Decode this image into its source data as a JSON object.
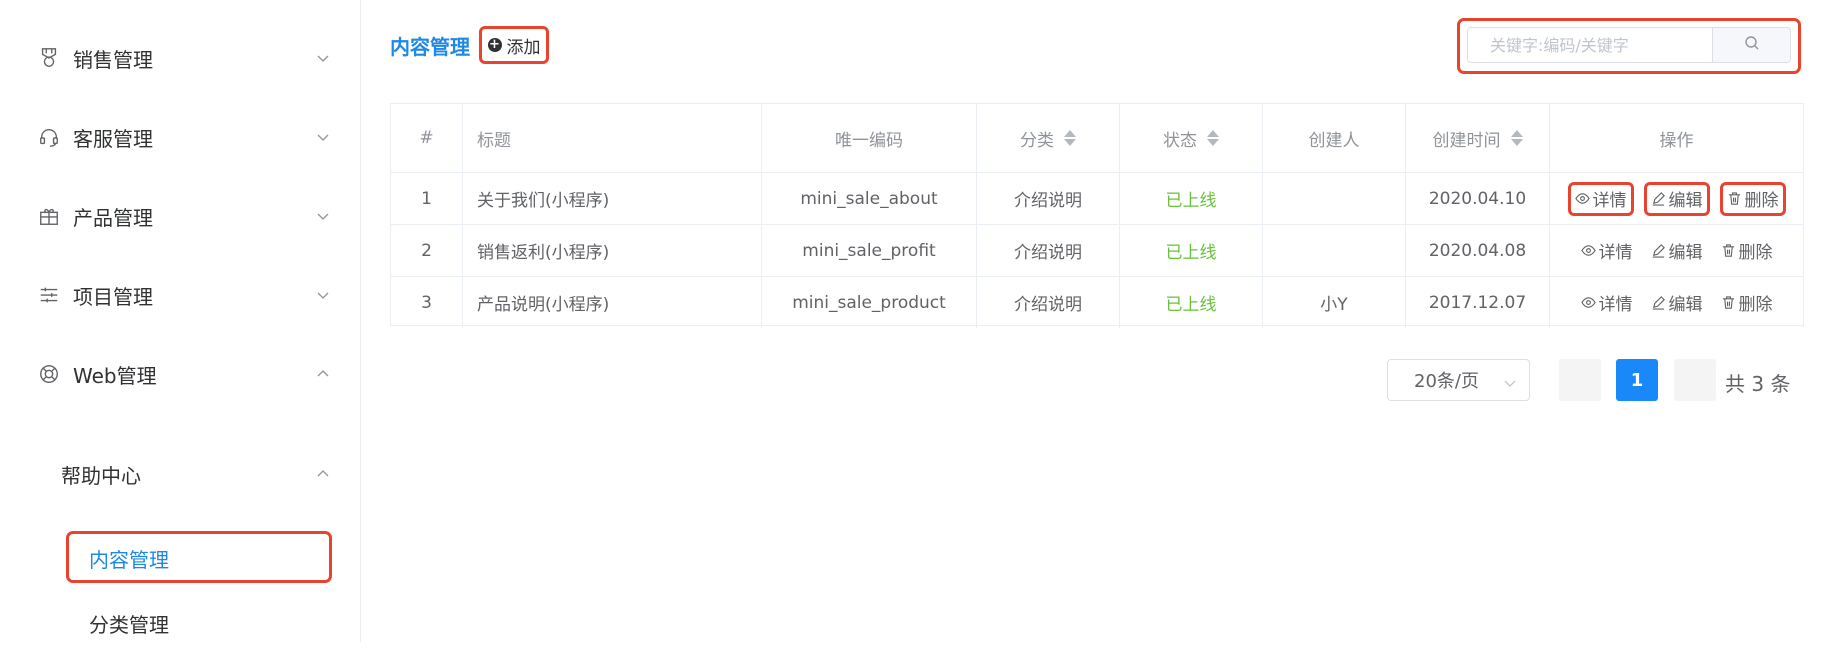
{
  "sidebar": {
    "items": [
      {
        "label": "销售管理",
        "icon": "medal-icon"
      },
      {
        "label": "客服管理",
        "icon": "headset-icon"
      },
      {
        "label": "产品管理",
        "icon": "gift-icon"
      },
      {
        "label": "项目管理",
        "icon": "sliders-icon"
      },
      {
        "label": "Web管理",
        "icon": "lifebuoy-icon"
      }
    ],
    "submenu": {
      "group_label": "帮助中心",
      "items": [
        {
          "label": "内容管理",
          "active": true
        },
        {
          "label": "分类管理",
          "active": false
        }
      ]
    }
  },
  "header": {
    "title": "内容管理",
    "add_label": "添加"
  },
  "search": {
    "placeholder": "关键字:编码/关键字"
  },
  "table": {
    "columns": [
      "#",
      "标题",
      "唯一编码",
      "分类",
      "状态",
      "创建人",
      "创建时间",
      "操作"
    ],
    "rows": [
      {
        "no": "1",
        "title": "关于我们(小程序)",
        "code": "mini_sale_about",
        "category": "介绍说明",
        "status": "已上线",
        "creator": "",
        "created": "2020.04.10"
      },
      {
        "no": "2",
        "title": "销售返利(小程序)",
        "code": "mini_sale_profit",
        "category": "介绍说明",
        "status": "已上线",
        "creator": "",
        "created": "2020.04.08"
      },
      {
        "no": "3",
        "title": "产品说明(小程序)",
        "code": "mini_sale_product",
        "category": "介绍说明",
        "status": "已上线",
        "creator": "小Y",
        "created": "2017.12.07"
      }
    ],
    "actions": {
      "detail": "详情",
      "edit": "编辑",
      "delete": "删除"
    }
  },
  "pagination": {
    "page_size": "20条/页",
    "current_page": "1",
    "total": "共 3 条"
  },
  "colors": {
    "accent": "#1989fa",
    "title_blue": "#1e88e5",
    "status_green": "#67c23a",
    "highlight_red": "#e8432e"
  }
}
